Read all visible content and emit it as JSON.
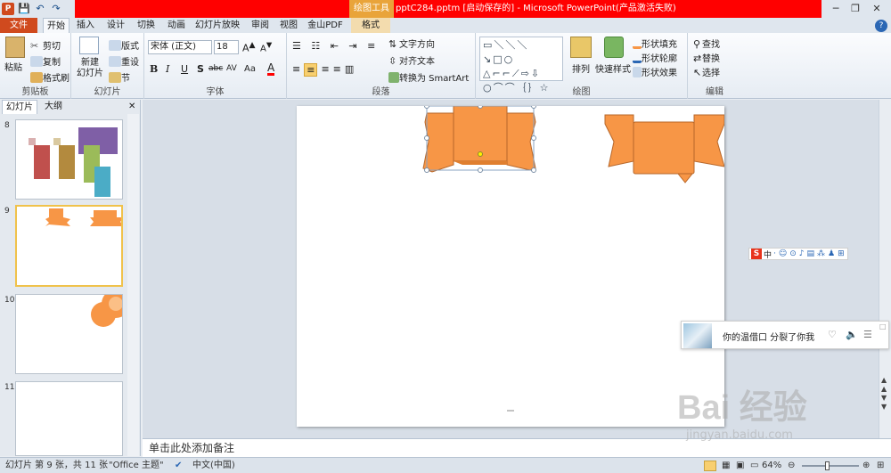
{
  "window": {
    "title": "pptC284.pptm [启动保存的] - Microsoft PowerPoint(产品激活失败)",
    "contextual_tool": "绘图工具",
    "controls": [
      "─",
      "❐",
      "✕"
    ]
  },
  "qat": {
    "logo": "P",
    "save": "💾",
    "undo": "↶",
    "redo": "↷"
  },
  "tabs": [
    {
      "label": "文件"
    },
    {
      "label": "开始"
    },
    {
      "label": "插入"
    },
    {
      "label": "设计"
    },
    {
      "label": "切换"
    },
    {
      "label": "动画"
    },
    {
      "label": "幻灯片放映"
    },
    {
      "label": "审阅"
    },
    {
      "label": "视图"
    },
    {
      "label": "金山PDF"
    },
    {
      "label": "格式"
    }
  ],
  "ribbon": {
    "clipboard": {
      "label": "剪贴板",
      "paste": "粘贴",
      "cut": "剪切",
      "copy": "复制",
      "format_painter": "格式刷"
    },
    "slides": {
      "label": "幻灯片",
      "new_slide": "新建\n幻灯片",
      "layout": "版式",
      "reset": "重设",
      "section": "节"
    },
    "font": {
      "label": "字体",
      "name": "宋体 (正文)",
      "size": "18",
      "bold": "B",
      "italic": "I",
      "underline": "U",
      "shadow": "S",
      "strike": "abc",
      "spacing": "AV",
      "case": "Aa",
      "color": "A"
    },
    "paragraph": {
      "label": "段落",
      "text_direction": "文字方向",
      "align_text": "对齐文本",
      "smartart": "转换为 SmartArt"
    },
    "drawing": {
      "label": "绘图",
      "arrange": "排列",
      "quick_styles": "快速样式",
      "shape_fill": "形状填充",
      "shape_outline": "形状轮廓",
      "shape_effects": "形状效果"
    },
    "editing": {
      "label": "编辑",
      "find": "查找",
      "replace": "替换",
      "select": "选择"
    }
  },
  "panel": {
    "tabs": [
      "幻灯片",
      "大纲"
    ],
    "close": "✕",
    "thumbnails": [
      {
        "num": "8"
      },
      {
        "num": "9",
        "selected": true
      },
      {
        "num": "10"
      },
      {
        "num": "11"
      }
    ]
  },
  "notes": {
    "placeholder": "单击此处添加备注"
  },
  "statusbar": {
    "slide_info": "幻灯片 第 9 张，共 11 张",
    "theme": "\"Office 主题\"",
    "language": "中文(中国)",
    "zoom": "64%",
    "zoom_level": 0.64
  },
  "ime": {
    "mode": "中"
  },
  "music_popup": {
    "text": "你的温借口 分裂了你我"
  },
  "watermark": {
    "brand": "Bai 经验",
    "url": "jingyan.baidu.com"
  },
  "colors": {
    "accent_orange": "#f79646",
    "orange_stroke": "#b7672a",
    "title_red": "#ff0000",
    "file_tab": "#d04a1e"
  }
}
